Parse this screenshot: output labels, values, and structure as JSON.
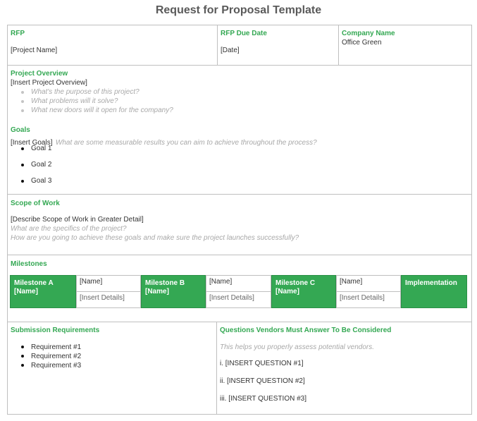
{
  "page_title": "Request for Proposal Template",
  "header": {
    "rfp_label": "RFP",
    "rfp_value": "[Project Name]",
    "due_label": "RFP Due Date",
    "due_value": "[Date]",
    "company_label": "Company Name",
    "company_value": "Office Green"
  },
  "overview": {
    "label": "Project Overview",
    "value": "[Insert Project Overview]",
    "prompts": [
      "What's the purpose of this project?",
      "What problems will it solve?",
      "What new doors will it open for the company?"
    ]
  },
  "goals": {
    "label": "Goals",
    "value": "[Insert Goals]",
    "hint": "What are some measurable results you can aim to achieve throughout the process?",
    "items": [
      "Goal 1",
      "Goal 2",
      "Goal 3"
    ]
  },
  "scope": {
    "label": "Scope of Work",
    "value": "[Describe Scope of Work in Greater Detail]",
    "hint1": "What are the specifics of the project?",
    "hint2": "How are you going to achieve these goals and make sure the project launches successfully?"
  },
  "milestones": {
    "label": "Milestones",
    "a_label": "Milestone A [Name]",
    "a_name": "[Name]",
    "a_details": "[Insert Details]",
    "b_label": "Milestone B [Name]",
    "b_name": "[Name]",
    "b_details": "[Insert Details]",
    "c_label": "Milestone C [Name]",
    "c_name": "[Name]",
    "c_details": "[Insert Details]",
    "implementation": "Implementation"
  },
  "submission": {
    "label": "Submission Requirements",
    "items": [
      "Requirement #1",
      "Requirement #2",
      "Requirement #3"
    ]
  },
  "questions": {
    "label": "Questions Vendors Must Answer To Be Considered",
    "hint": "This helps you properly assess potential vendors.",
    "q1": "i. [INSERT QUESTION #1]",
    "q2": "ii. [INSERT QUESTION #2]",
    "q3": "iii. [INSERT QUESTION #3]"
  },
  "colors": {
    "accent": "#34a853",
    "border": "#bfbfbf",
    "hint": "#a8a8a8"
  }
}
